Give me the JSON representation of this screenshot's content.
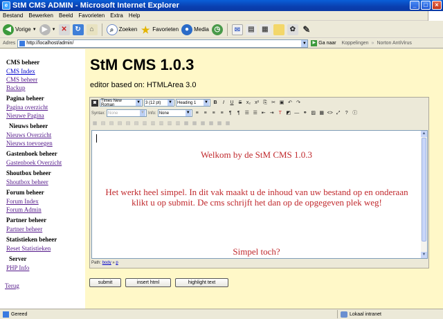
{
  "window": {
    "title": "StM CMS ADMIN - Microsoft Internet Explorer",
    "controls": [
      "_",
      "□",
      "×"
    ]
  },
  "menu": [
    "Bestand",
    "Bewerken",
    "Beeld",
    "Favorieten",
    "Extra",
    "Help"
  ],
  "toolbar": {
    "back_label": "Vorige",
    "search_label": "Zoeken",
    "favorites_label": "Favorieten",
    "media_label": "Media"
  },
  "address": {
    "label": "Adres",
    "url": "http://localhost/admin/",
    "go_label": "Ga naar",
    "links_label": "Koppelingen",
    "norton_label": "Norton AntiVirus"
  },
  "sidebar": {
    "sections": [
      {
        "heading": "CMS beheer",
        "links": [
          "CMS Index",
          "CMS beheer",
          "Backup"
        ]
      },
      {
        "heading": "Pagina beheer",
        "links": [
          "Pagina overzicht",
          "Nieuwe Pagina"
        ]
      },
      {
        "heading": "Nieuws beheer",
        "links": [
          "Nieuws Overzicht",
          "Nieuws toevoegen"
        ]
      },
      {
        "heading": "Gastenboek beheer",
        "links": [
          "Gastenboek Overzicht"
        ]
      },
      {
        "heading": "Shoutbox beheer",
        "links": [
          "Shoutbox beheer"
        ]
      },
      {
        "heading": "Forum beheer",
        "links": [
          "Forum Index",
          "Forum Admin"
        ]
      },
      {
        "heading": "Partner beheer",
        "links": [
          "Partner beheer"
        ]
      },
      {
        "heading": "Statistieken beheer",
        "links": [
          "Reset Statistieken"
        ]
      },
      {
        "heading": "Server",
        "links": [
          "PHP Info"
        ]
      }
    ],
    "back_link": "Terug"
  },
  "main": {
    "title": "StM CMS 1.0.3",
    "subtitle": "editor based on: HTMLArea 3.0"
  },
  "editor": {
    "font_name": "Times New Roman",
    "font_size": "3 (12 pt)",
    "format": "Heading 1",
    "syntax_label": "Syntax:",
    "syntax_value": "None",
    "info_label": "Info:",
    "info_value": "None",
    "content_welcome": "Welkom by de StM CMS 1.0.3",
    "content_body": "Het werkt heel simpel. In dit vak maakt u de inhoud van uw bestand op en onderaan klikt u op submit. De cms schrijft het dan op de opgegeven plek weg!",
    "content_closing": "Simpel toch?",
    "path_label": "Path:",
    "path_body": "body",
    "path_sep": "»",
    "path_p": "p"
  },
  "buttons": {
    "submit": "submit",
    "insert_html": "insert html",
    "highlight_text": "highlight text"
  },
  "statusbar": {
    "status": "Gereed",
    "zone": "Lokaal intranet"
  }
}
